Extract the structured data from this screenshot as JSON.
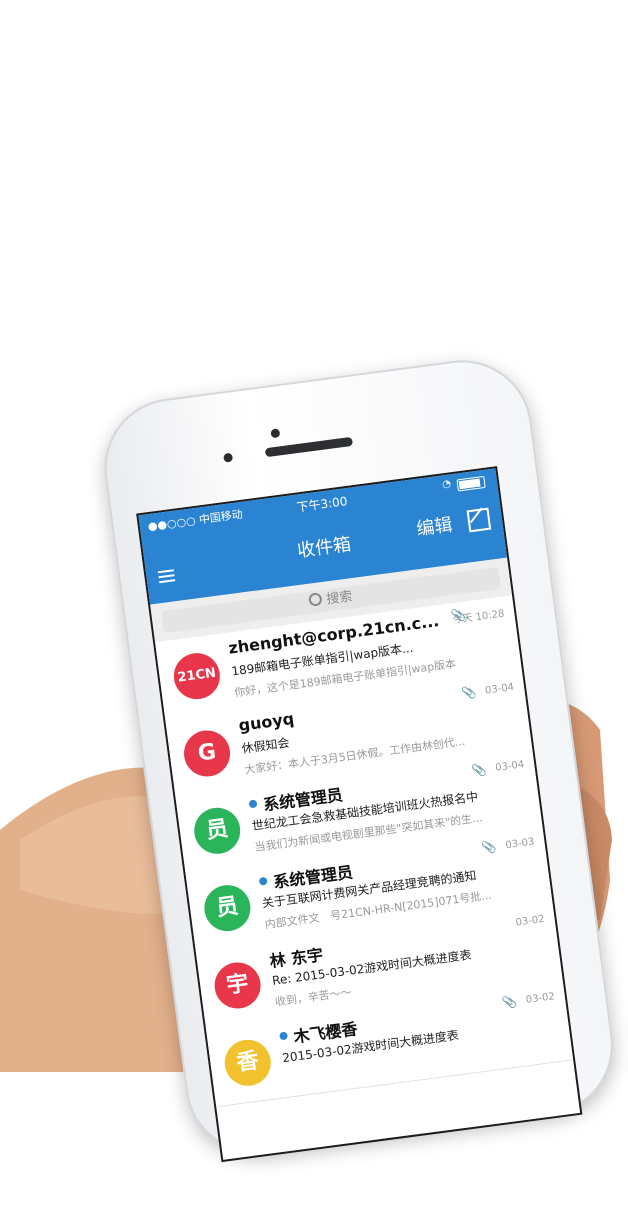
{
  "status_bar": {
    "carrier": "●●○○○ 中国移动",
    "time": "下午3:00"
  },
  "nav": {
    "title": "收件箱",
    "edit_label": "编辑"
  },
  "search": {
    "placeholder": "搜索"
  },
  "emails": [
    {
      "sender": "zhenght@corp.21cn.c...",
      "subject": "189邮箱电子账单指引|wap版本...",
      "preview": "你好，这个是189邮箱电子账单指引|wap版本",
      "date": "今天 10:28",
      "avatar_text": "21CN",
      "avatar_color": "#e8374a",
      "unread": false,
      "attachment": true
    },
    {
      "sender": "guoyq",
      "subject": "休假知会",
      "preview": "大家好：本人于3月5日休假。工作由林创代...",
      "date": "03-04",
      "avatar_text": "G",
      "avatar_color": "#e8374a",
      "unread": false,
      "attachment": true
    },
    {
      "sender": "系统管理员",
      "subject": "世纪龙工会急救基础技能培训班火热报名中",
      "preview": "当我们为新闻或电视剧里那些\"突如其来\"的生...",
      "date": "03-04",
      "avatar_text": "员",
      "avatar_color": "#2bb55a",
      "unread": true,
      "attachment": true
    },
    {
      "sender": "系统管理员",
      "subject": "关于互联网计费网关产品经理竞聘的通知",
      "preview": "内部文件文　号21CN-HR-N[2015]071号批...",
      "date": "03-03",
      "avatar_text": "员",
      "avatar_color": "#2bb55a",
      "unread": true,
      "attachment": true
    },
    {
      "sender": "林 东宇",
      "subject": "Re: 2015-03-02游戏时间大概进度表",
      "preview": "收到，辛苦～～",
      "date": "03-02",
      "avatar_text": "宇",
      "avatar_color": "#e8374a",
      "unread": false,
      "attachment": false
    },
    {
      "sender": "木飞樱香",
      "subject": "2015-03-02游戏时间大概进度表",
      "preview": "",
      "date": "03-02",
      "avatar_text": "香",
      "avatar_color": "#f2c12e",
      "unread": true,
      "attachment": true
    }
  ]
}
